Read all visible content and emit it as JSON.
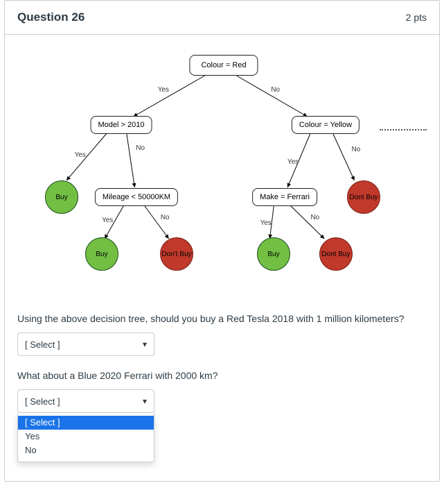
{
  "question": {
    "title": "Question 26",
    "points": "2 pts"
  },
  "tree": {
    "root": "Colour = Red",
    "model": "Model > 2010",
    "mile": "Mileage < 50000KM",
    "colyel": "Colour = Yellow",
    "make": "Make = Ferrari",
    "buy": "Buy",
    "dont": "Dont Buy",
    "dont_apos": "Don't Buy",
    "yes": "Yes",
    "no": "No"
  },
  "prompt1": "Using the above decision tree, should you buy a Red Tesla 2018 with 1 million kilometers?",
  "prompt2": "What about a Blue 2020 Ferrari with 2000 km?",
  "select": {
    "placeholder": "[ Select ]"
  },
  "dropdown": {
    "visible": true,
    "selected_index": 0,
    "options": [
      "[ Select ]",
      "Yes",
      "No"
    ]
  }
}
